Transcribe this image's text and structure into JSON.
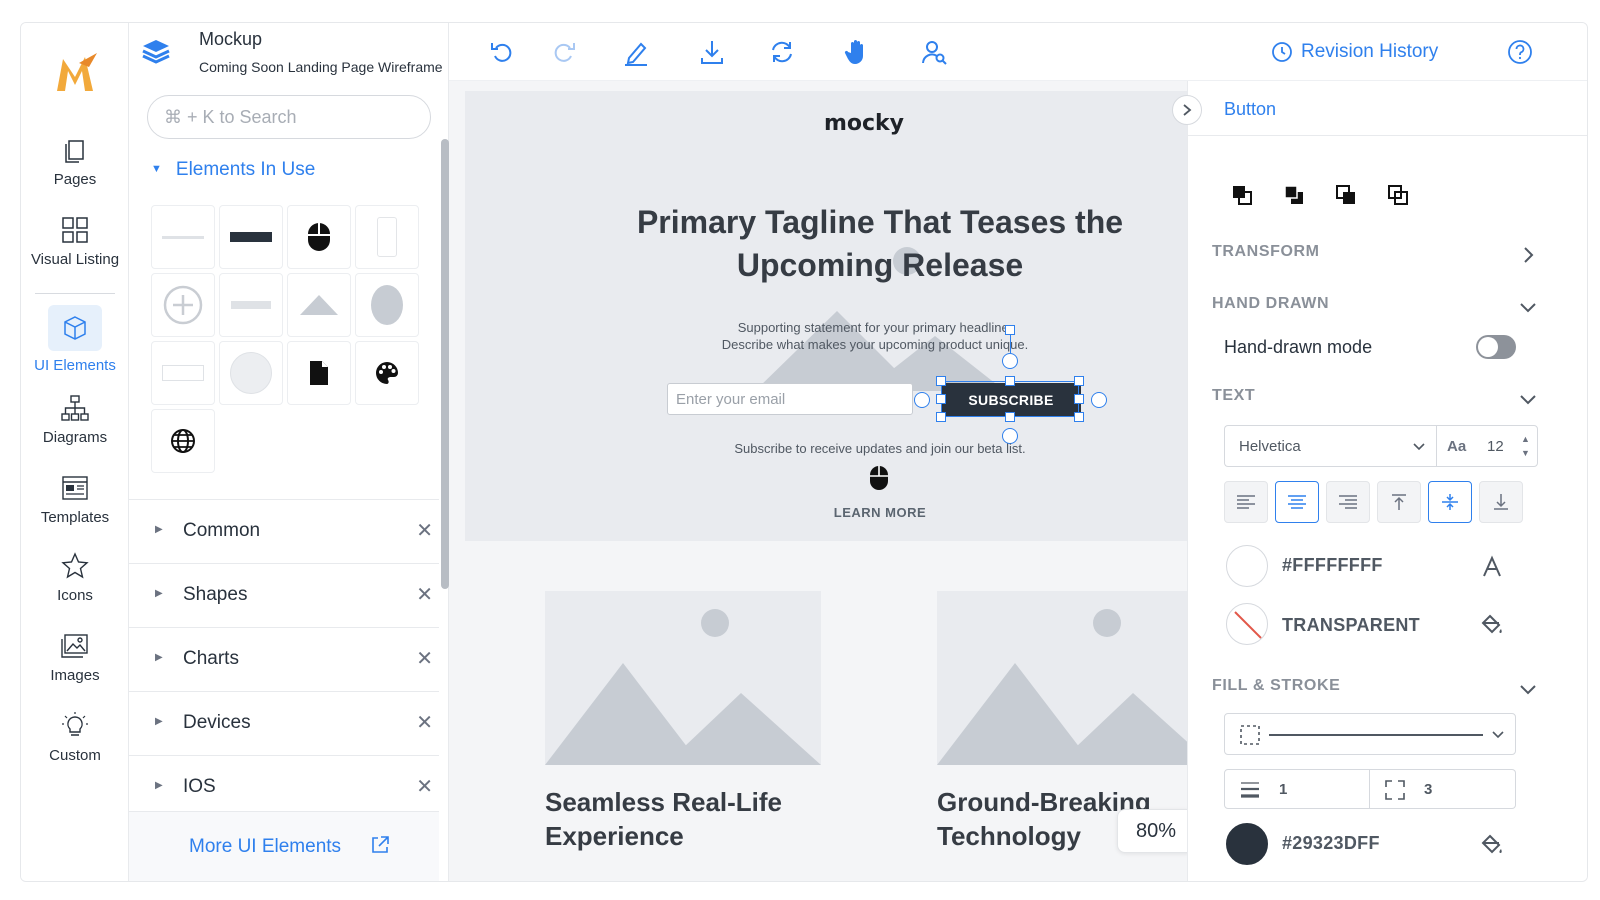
{
  "app": {
    "doc_title": "Mockup",
    "doc_subtitle": "Coming Soon Landing Page Wireframe"
  },
  "rail": {
    "items": [
      {
        "label": "Pages",
        "icon": "pages-icon"
      },
      {
        "label": "Visual Listing",
        "icon": "grid-icon"
      },
      {
        "label": "UI Elements",
        "icon": "cube-icon",
        "active": true
      },
      {
        "label": "Diagrams",
        "icon": "sitemap-icon"
      },
      {
        "label": "Templates",
        "icon": "template-icon"
      },
      {
        "label": "Icons",
        "icon": "star-icon"
      },
      {
        "label": "Images",
        "icon": "image-icon"
      },
      {
        "label": "Custom",
        "icon": "lightbulb-icon"
      }
    ]
  },
  "panel": {
    "search_placeholder": "⌘ + K to Search",
    "in_use_label": "Elements In Use",
    "categories": [
      "Common",
      "Shapes",
      "Charts",
      "Devices",
      "IOS"
    ],
    "more_label": "More UI Elements"
  },
  "toolbar": {
    "revision_label": "Revision History"
  },
  "canvas": {
    "brand": "mocky",
    "tagline": "Primary Tagline That Teases the Upcoming Release",
    "support_line1": "Supporting statement for your primary headline.",
    "support_line2": "Describe what makes your upcoming product unique.",
    "email_placeholder": "Enter your email",
    "subscribe_label": "SUBSCRIBE",
    "sub_note": "Subscribe to receive updates and join our beta list.",
    "learn_more": "LEARN MORE",
    "card1_title": "Seamless Real-Life Experience",
    "card2_title": "Ground-Breaking Technology",
    "zoom": "80%"
  },
  "inspector": {
    "title": "Button",
    "sections": {
      "transform": "TRANSFORM",
      "hand_drawn": "HAND DRAWN",
      "text": "TEXT",
      "fill_stroke": "FILL & STROKE"
    },
    "hand_drawn_label": "Hand-drawn mode",
    "hand_drawn_on": false,
    "font": "Helvetica",
    "font_size_prefix": "Aa",
    "font_size": "12",
    "text_color": "#FFFFFFFF",
    "bg_color": "TRANSPARENT",
    "stroke_width": "1",
    "corner_radius": "3",
    "fill_color": "#29323DFF"
  },
  "colors": {
    "accent": "#2f80ed",
    "dark": "#29323d",
    "placeholder": "#c7ccd3"
  }
}
